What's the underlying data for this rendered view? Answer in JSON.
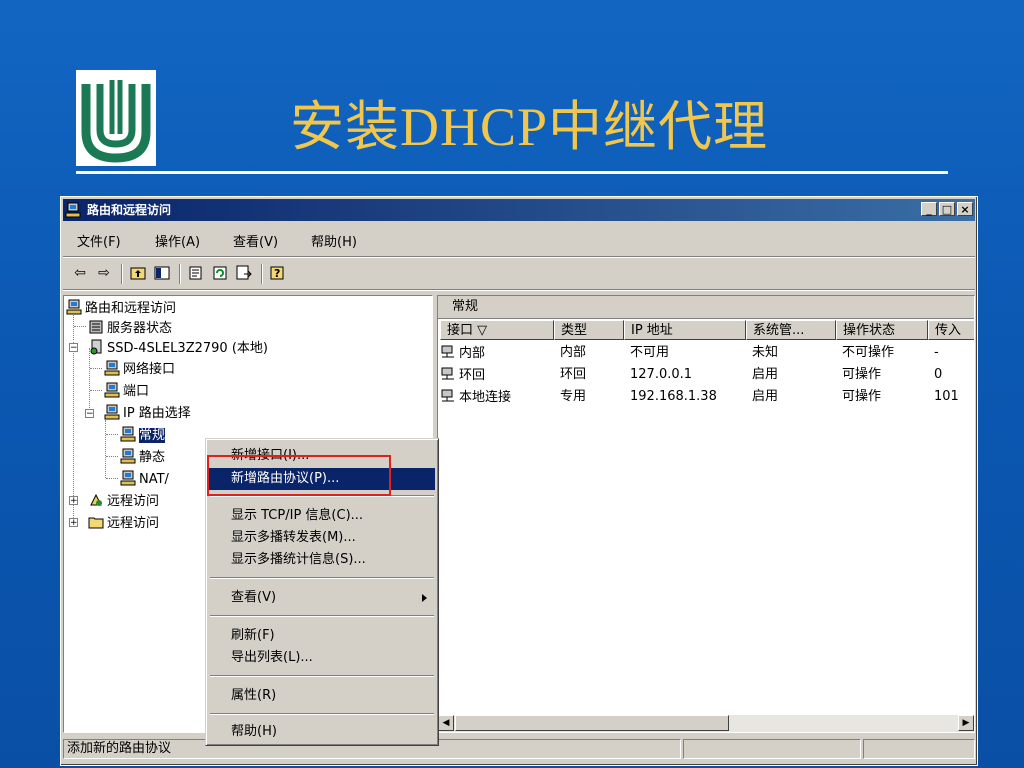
{
  "slide": {
    "title": "安装DHCP中继代理"
  },
  "window": {
    "title": "路由和远程访问",
    "controls": {
      "minimize": "_",
      "maximize": "□",
      "close": "×"
    }
  },
  "menubar": [
    "文件(F)",
    "操作(A)",
    "查看(V)",
    "帮助(H)"
  ],
  "tree": {
    "root": "路由和远程访问",
    "server_status": "服务器状态",
    "server": "SSD-4SLEL3Z2790 (本地)",
    "network_interfaces": "网络接口",
    "ports": "端口",
    "ip_routing": "IP 路由选择",
    "general": "常规",
    "static": "静态",
    "nat": "NAT/",
    "remote_access_1": "远程访问",
    "remote_access_2": "远程访问"
  },
  "right_pane": {
    "title": "常规",
    "columns": [
      "接口 ▽",
      "类型",
      "IP 地址",
      "系统管...",
      "操作状态",
      "传入"
    ],
    "rows": [
      {
        "name": "内部",
        "type": "内部",
        "ip": "不可用",
        "admin": "未知",
        "oper": "不可操作",
        "in": "-"
      },
      {
        "name": "环回",
        "type": "环回",
        "ip": "127.0.0.1",
        "admin": "启用",
        "oper": "可操作",
        "in": "0"
      },
      {
        "name": "本地连接",
        "type": "专用",
        "ip": "192.168.1.38",
        "admin": "启用",
        "oper": "可操作",
        "in": "101"
      }
    ]
  },
  "context_menu": {
    "new_interface": "新增接口(I)...",
    "new_protocol": "新增路由协议(P)...",
    "show_tcpip": "显示 TCP/IP 信息(C)...",
    "show_mcast_fwd": "显示多播转发表(M)...",
    "show_mcast_stats": "显示多播统计信息(S)...",
    "view": "查看(V)",
    "refresh": "刷新(F)",
    "export": "导出列表(L)...",
    "properties": "属性(R)",
    "help": "帮助(H)"
  },
  "statusbar": {
    "text": "添加新的路由协议"
  },
  "colors": {
    "highlight": "#0a246a",
    "callout": "#e0201c",
    "title_text": "#f0c64c"
  }
}
